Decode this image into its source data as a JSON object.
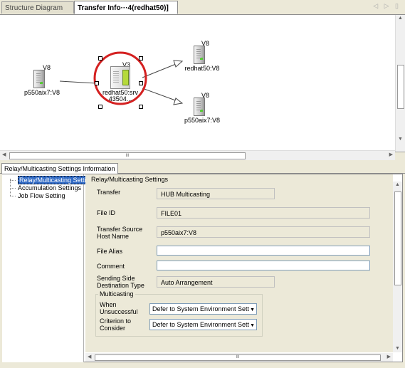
{
  "tabs": {
    "structure_diagram": "Structure Diagram",
    "transfer_info": "Transfer Info···4(redhat50)]"
  },
  "diagram": {
    "nodes": {
      "source": {
        "version": "V8",
        "label": "p550aix7:V8"
      },
      "center": {
        "version": "V3",
        "label_line1": "redhat50:srv",
        "label_line2": "43504..."
      },
      "dest_top": {
        "version": "V8",
        "label": "redhat50:V8"
      },
      "dest_bottom": {
        "version": "V8",
        "label": "p550aix7:V8"
      }
    },
    "scroll_grip": "III"
  },
  "panel": {
    "tab_label": "Relay/Multicasting Settings Information",
    "tree": [
      "Relay/Multicasting Setti",
      "Accumulation Settings",
      "Job Flow Setting"
    ],
    "section_title": "Relay/Multicasting Settings",
    "fields": {
      "transfer": {
        "label": "Transfer",
        "value": "HUB Multicasting"
      },
      "file_id": {
        "label": "File ID",
        "value": "FILE01"
      },
      "source_host_l1": "Transfer Source",
      "source_host_l2": "Host Name",
      "source_host_value": "p550aix7:V8",
      "file_alias": {
        "label": "File Alias",
        "value": ""
      },
      "comment": {
        "label": "Comment",
        "value": ""
      },
      "dest_type_l1": "Sending Side",
      "dest_type_l2": "Destination Type",
      "dest_type_value": "Auto Arrangement"
    },
    "multicasting": {
      "legend": "Multicasting",
      "when_l1": "When",
      "when_l2": "Unsuccessful",
      "when_value": "Defer to System Environment Sett",
      "criterion_l1": "Criterion to",
      "criterion_l2": "Consider",
      "criterion_value": "Defer to System Environment Sett"
    },
    "scroll_grip": "III"
  },
  "colors": {
    "selection_circle": "#d42020",
    "tree_selection": "#316ac5",
    "window_bg": "#ece9d8"
  }
}
